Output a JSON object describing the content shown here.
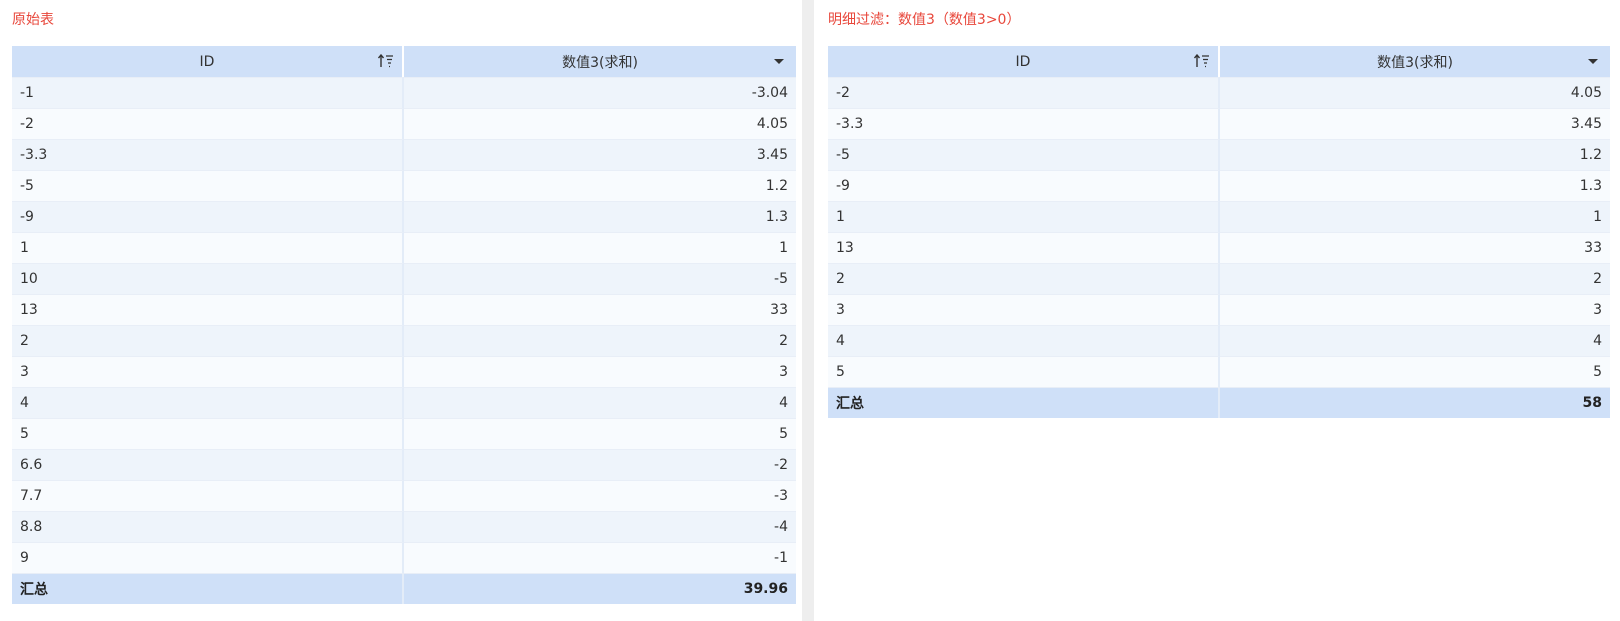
{
  "colors": {
    "title": "#e8473b",
    "header_bg": "#cfe0f8",
    "row_odd": "#eef4fb",
    "row_even": "#f8fbfe"
  },
  "left_panel": {
    "title": "原始表",
    "columns": [
      "ID",
      "数值3(求和)"
    ],
    "rows": [
      [
        "-1",
        "-3.04"
      ],
      [
        "-2",
        "4.05"
      ],
      [
        "-3.3",
        "3.45"
      ],
      [
        "-5",
        "1.2"
      ],
      [
        "-9",
        "1.3"
      ],
      [
        "1",
        "1"
      ],
      [
        "10",
        "-5"
      ],
      [
        "13",
        "33"
      ],
      [
        "2",
        "2"
      ],
      [
        "3",
        "3"
      ],
      [
        "4",
        "4"
      ],
      [
        "5",
        "5"
      ],
      [
        "6.6",
        "-2"
      ],
      [
        "7.7",
        "-3"
      ],
      [
        "8.8",
        "-4"
      ],
      [
        "9",
        "-1"
      ]
    ],
    "total": [
      "汇总",
      "39.96"
    ],
    "icons": {
      "id_header": "sort-filter-icon",
      "value_header": "dropdown-icon"
    }
  },
  "right_panel": {
    "title": "明细过滤：数值3（数值3>0）",
    "columns": [
      "ID",
      "数值3(求和)"
    ],
    "rows": [
      [
        "-2",
        "4.05"
      ],
      [
        "-3.3",
        "3.45"
      ],
      [
        "-5",
        "1.2"
      ],
      [
        "-9",
        "1.3"
      ],
      [
        "1",
        "1"
      ],
      [
        "13",
        "33"
      ],
      [
        "2",
        "2"
      ],
      [
        "3",
        "3"
      ],
      [
        "4",
        "4"
      ],
      [
        "5",
        "5"
      ]
    ],
    "total": [
      "汇总",
      "58"
    ],
    "icons": {
      "id_header": "sort-filter-icon",
      "value_header": "dropdown-icon"
    }
  }
}
